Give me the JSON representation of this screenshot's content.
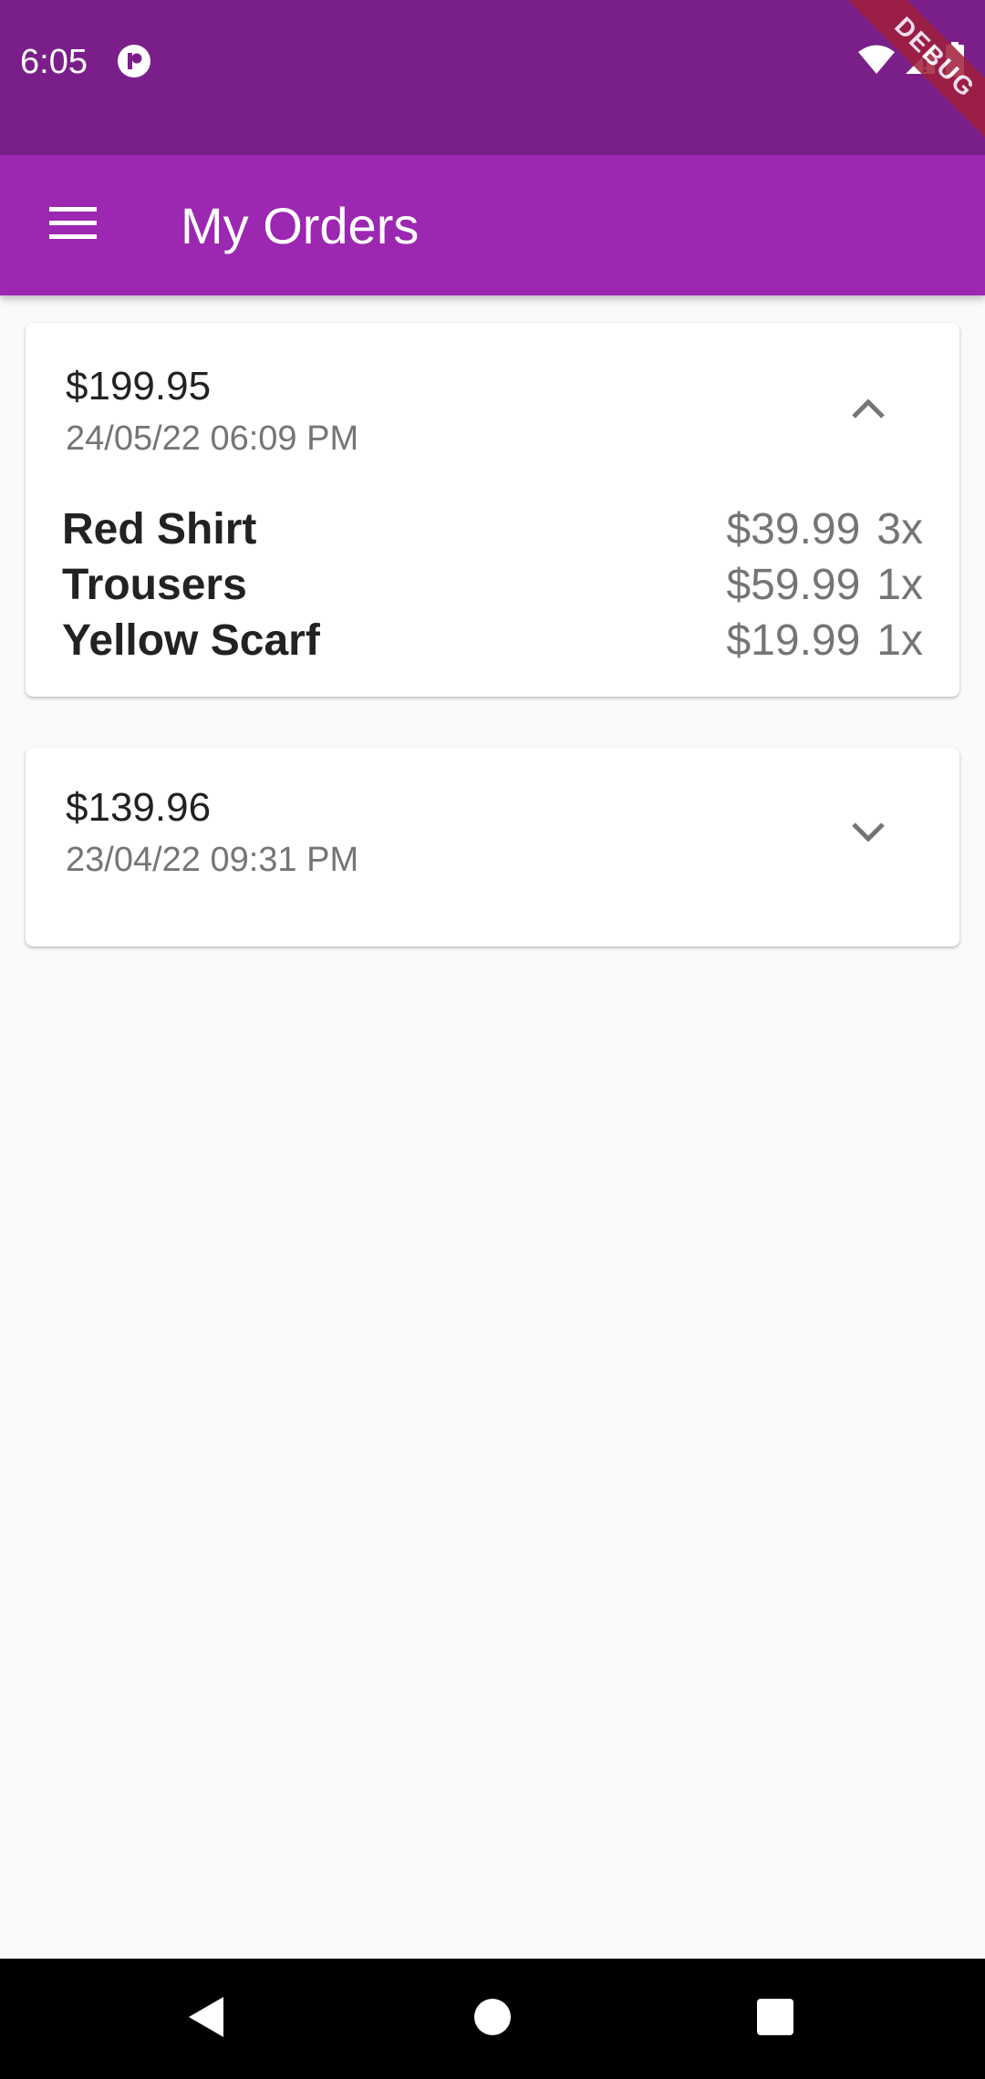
{
  "status_bar": {
    "time": "6:05",
    "app_icon": "p-circle-icon",
    "icons": [
      "wifi-icon",
      "signal-icon",
      "battery-icon"
    ]
  },
  "debug_banner": {
    "label": "DEBUG"
  },
  "app_bar": {
    "menu_icon": "menu-icon",
    "title": "My Orders"
  },
  "orders": [
    {
      "amount": "$199.95",
      "date": "24/05/22  06:09 PM",
      "expanded": true,
      "toggle_icon": "chevron-up-icon",
      "items": [
        {
          "name": "Red Shirt",
          "price": "$39.99",
          "quantity": "3x"
        },
        {
          "name": "Trousers",
          "price": "$59.99",
          "quantity": "1x"
        },
        {
          "name": "Yellow Scarf",
          "price": "$19.99",
          "quantity": "1x"
        }
      ]
    },
    {
      "amount": "$139.96",
      "date": "23/04/22  09:31 PM",
      "expanded": false,
      "toggle_icon": "chevron-down-icon",
      "items": []
    }
  ],
  "nav_bar": {
    "icons": [
      "back-icon",
      "home-icon",
      "recents-icon"
    ]
  },
  "colors": {
    "status_bar": "#7A1F8A",
    "app_bar": "#9C27B0",
    "background": "#FAFAFA",
    "card": "#FFFFFF",
    "primary_text": "#222222",
    "secondary_text": "#757575",
    "debug_ribbon": "#A01E3A"
  }
}
